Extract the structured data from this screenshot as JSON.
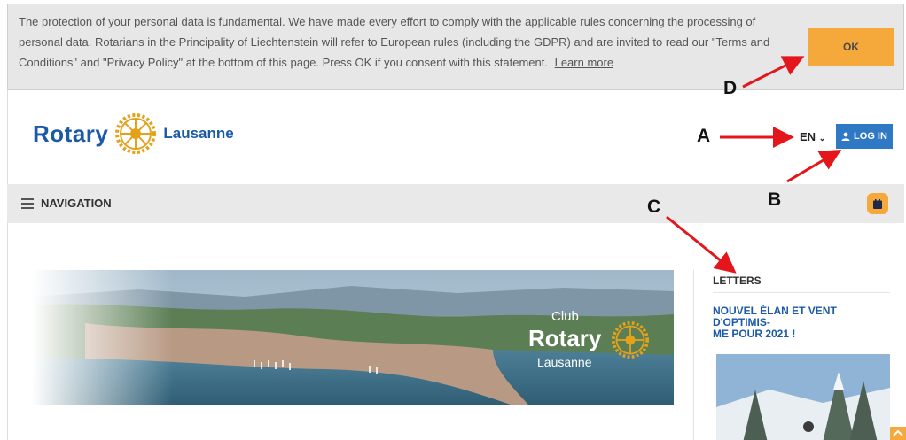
{
  "cookie_banner": {
    "line1": "The protection of your personal data is fundamental. We have made every effort to comply with the applicable rules concerning the processing of",
    "line2": "personal data. Rotarians in the Principality of Liechtenstein will refer to European rules (including the GDPR) and are invited to read our \"Terms and",
    "line3": "Conditions\" and \"Privacy Policy\" at the bottom of this page. Press OK if you consent with this statement.",
    "learn_more": "Learn more",
    "ok_label": "OK"
  },
  "header": {
    "logo_word": "Rotary",
    "logo_sub": "Lausanne",
    "language": "EN",
    "login_label": "LOG IN"
  },
  "navbar": {
    "label": "NAVIGATION"
  },
  "hero": {
    "club": "Club",
    "rotary": "Rotary",
    "lausanne": "Lausanne"
  },
  "sidebar": {
    "heading": "LETTERS",
    "letter_title_1": "NOUVEL ÉLAN ET VENT D'OPTIMIS-",
    "letter_title_2": "ME POUR 2021 !"
  },
  "annotations": {
    "a": "A",
    "b": "B",
    "c": "C",
    "d": "D"
  },
  "colors": {
    "accent_orange": "#f5a93a",
    "rotary_blue": "#1a5aa6",
    "rotary_gold": "#e3a21a",
    "annotation_red": "#e4151b"
  },
  "icons": [
    "user-icon",
    "chevron-down-icon",
    "hamburger-icon",
    "calendar-icon",
    "rotary-wheel-icon",
    "chevron-up-icon"
  ]
}
